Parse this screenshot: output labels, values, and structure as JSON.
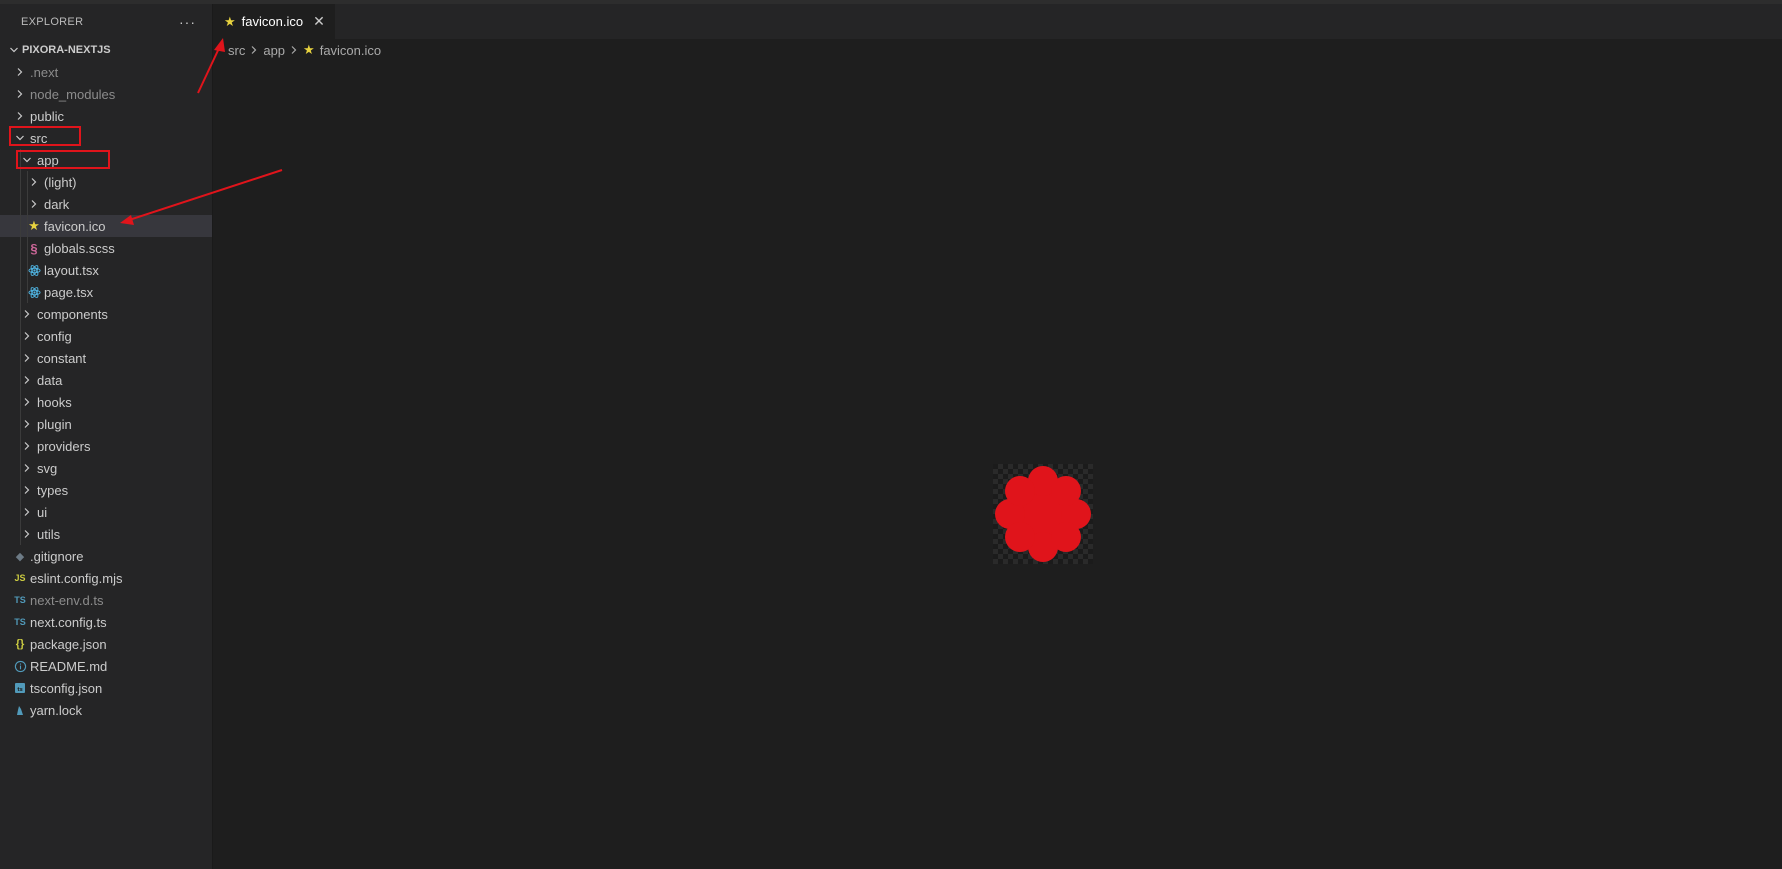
{
  "colors": {
    "accent_red": "#e0141b",
    "star_yellow": "#e8d33f",
    "ts_blue": "#519aba",
    "react_blue": "#4fb3e0",
    "scss_pink": "#cd6799",
    "js_yellow": "#cbcb41"
  },
  "sidebar": {
    "title": "EXPLORER",
    "more_label": "···",
    "project_name": "PIXORA-NEXTJS",
    "items": [
      {
        "label": ".next",
        "type": "folder",
        "state": "collapsed",
        "dim": true
      },
      {
        "label": "node_modules",
        "type": "folder",
        "state": "collapsed",
        "dim": true
      },
      {
        "label": "public",
        "type": "folder",
        "state": "collapsed"
      },
      {
        "label": "src",
        "type": "folder",
        "state": "expanded"
      },
      {
        "label": "app",
        "type": "folder",
        "state": "expanded"
      },
      {
        "label": "(light)",
        "type": "folder",
        "state": "collapsed"
      },
      {
        "label": "dark",
        "type": "folder",
        "state": "collapsed"
      },
      {
        "label": "favicon.ico",
        "type": "file",
        "icon": "star-icon",
        "selected": true
      },
      {
        "label": "globals.scss",
        "type": "file",
        "icon": "sass-icon"
      },
      {
        "label": "layout.tsx",
        "type": "file",
        "icon": "react-icon"
      },
      {
        "label": "page.tsx",
        "type": "file",
        "icon": "react-icon"
      },
      {
        "label": "components",
        "type": "folder",
        "state": "collapsed"
      },
      {
        "label": "config",
        "type": "folder",
        "state": "collapsed"
      },
      {
        "label": "constant",
        "type": "folder",
        "state": "collapsed"
      },
      {
        "label": "data",
        "type": "folder",
        "state": "collapsed"
      },
      {
        "label": "hooks",
        "type": "folder",
        "state": "collapsed"
      },
      {
        "label": "plugin",
        "type": "folder",
        "state": "collapsed"
      },
      {
        "label": "providers",
        "type": "folder",
        "state": "collapsed"
      },
      {
        "label": "svg",
        "type": "folder",
        "state": "collapsed"
      },
      {
        "label": "types",
        "type": "folder",
        "state": "collapsed"
      },
      {
        "label": "ui",
        "type": "folder",
        "state": "collapsed"
      },
      {
        "label": "utils",
        "type": "folder",
        "state": "collapsed"
      },
      {
        "label": ".gitignore",
        "type": "file",
        "icon": "git-icon"
      },
      {
        "label": "eslint.config.mjs",
        "type": "file",
        "icon": "js-icon",
        "icon_text": "JS"
      },
      {
        "label": "next-env.d.ts",
        "type": "file",
        "icon": "ts-icon",
        "icon_text": "TS",
        "dim": true
      },
      {
        "label": "next.config.ts",
        "type": "file",
        "icon": "ts-icon",
        "icon_text": "TS"
      },
      {
        "label": "package.json",
        "type": "file",
        "icon": "json-icon",
        "icon_text": "{}"
      },
      {
        "label": "README.md",
        "type": "file",
        "icon": "info-icon"
      },
      {
        "label": "tsconfig.json",
        "type": "file",
        "icon": "tsconfig-icon"
      },
      {
        "label": "yarn.lock",
        "type": "file",
        "icon": "yarn-icon"
      }
    ]
  },
  "editor": {
    "tab": {
      "label": "favicon.ico",
      "close_label": "✕"
    },
    "breadcrumb": [
      "src",
      "app",
      "favicon.ico"
    ]
  }
}
